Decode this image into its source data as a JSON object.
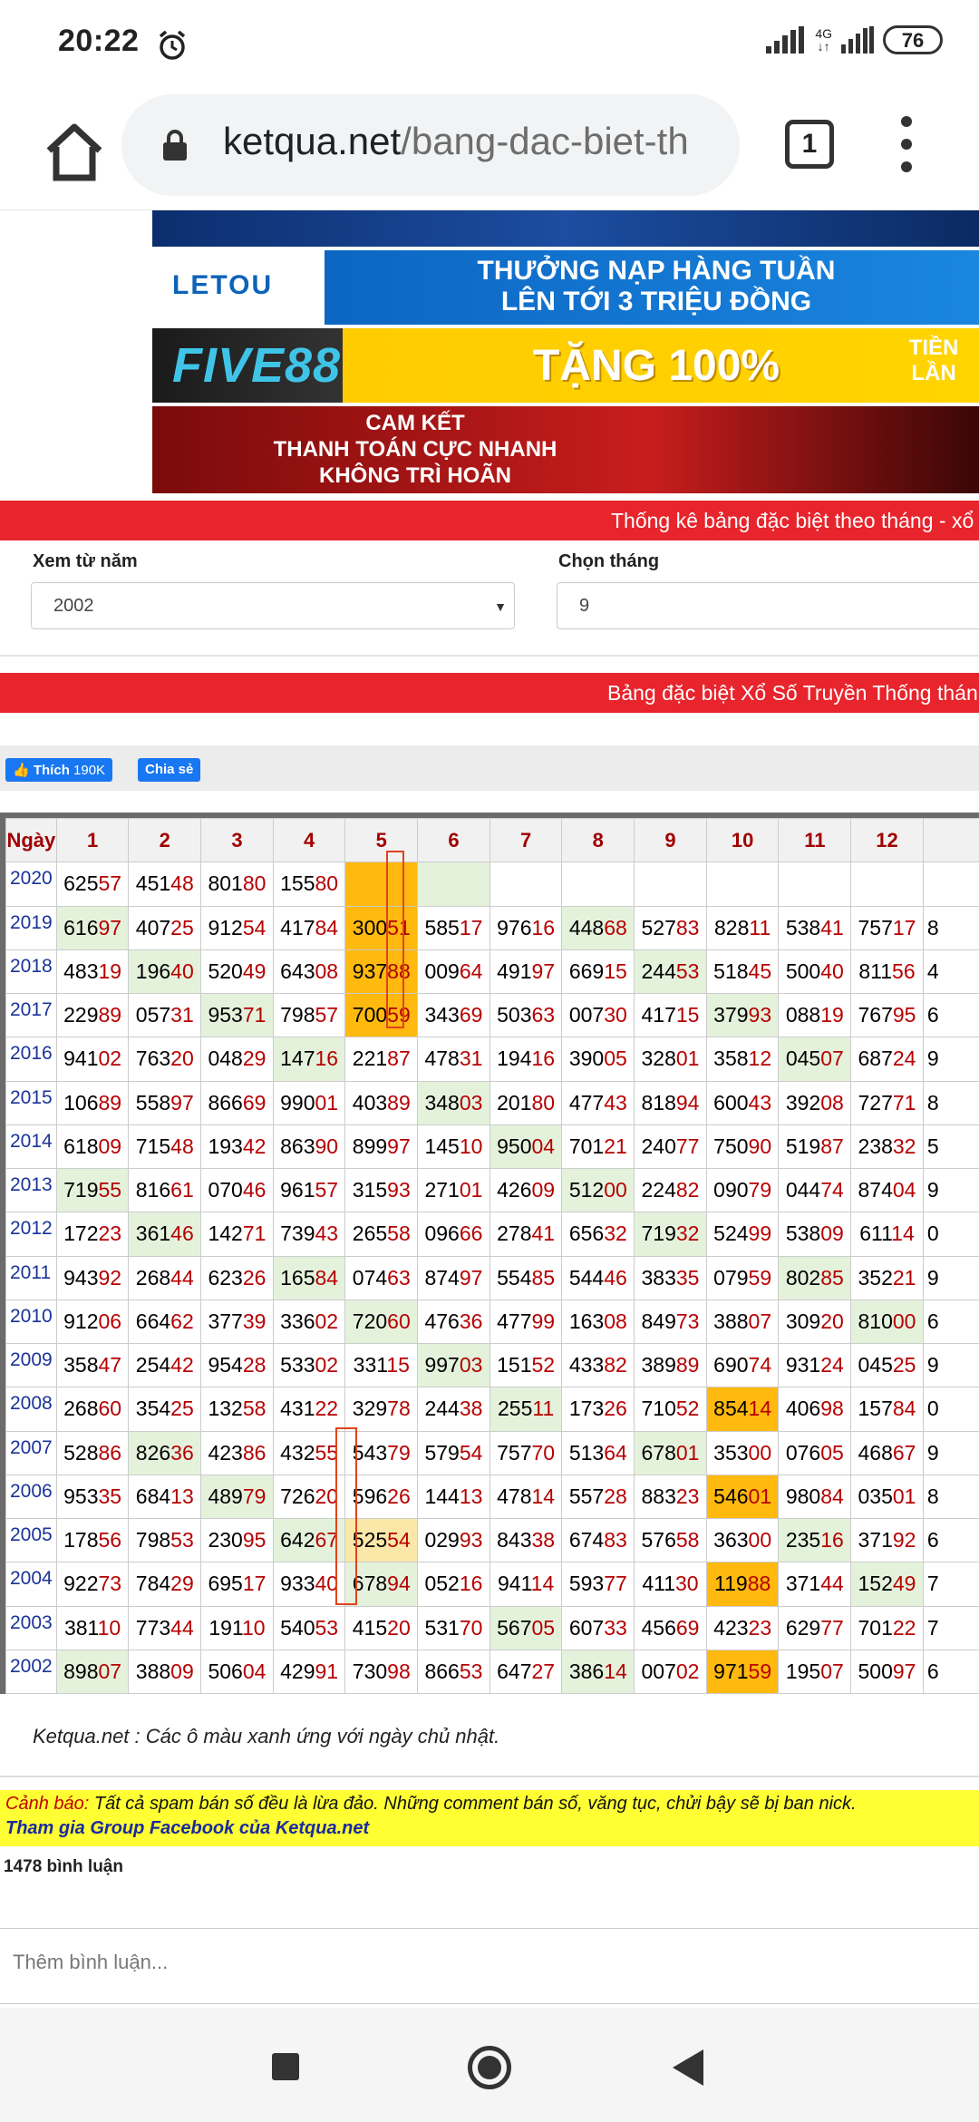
{
  "status_bar": {
    "time": "20:22",
    "network": "4G",
    "battery": "76"
  },
  "browser": {
    "url_domain": "ketqua.net",
    "url_path": "/bang-dac-biet-th",
    "tab_count": "1"
  },
  "banners": [
    {
      "logo": "LETOU",
      "text_line1": "THƯỞNG NẠP HÀNG TUẦN",
      "text_line2": "LÊN TỚI 3 TRIỆU ĐỒNG"
    },
    {
      "logo": "FIVE88",
      "text": "TẶNG 100%",
      "side": "TIỀN LẦN"
    },
    {
      "line1": "CAM KẾT",
      "line2": "THANH TOÁN CỰC NHANH",
      "line3": "KHÔNG TRÌ HOÃN"
    }
  ],
  "section1_title": "Thống kê bảng đặc biệt theo tháng - xổ",
  "filters": {
    "year_label": "Xem từ năm",
    "year_value": "2002",
    "month_label": "Chọn tháng",
    "month_value": "9"
  },
  "section2_title": "Bảng đặc biệt Xổ Số Truyền Thống thán",
  "social": {
    "like_label": "Thích",
    "like_count": "190K",
    "share_label": "Chia sẻ"
  },
  "table": {
    "header_label": "Ngày",
    "columns": [
      "1",
      "2",
      "3",
      "4",
      "5",
      "6",
      "7",
      "8",
      "9",
      "10",
      "11",
      "12"
    ],
    "rows": [
      {
        "year": "2020",
        "cells": [
          "62557",
          "45148",
          "80180",
          "15580",
          "",
          "",
          "",
          "",
          "",
          "",
          "",
          ""
        ],
        "extra": ""
      },
      {
        "year": "2019",
        "cells": [
          "61697",
          "40725",
          "91254",
          "41784",
          "30051",
          "58517",
          "97616",
          "44868",
          "52783",
          "82811",
          "53841",
          "75717"
        ],
        "extra": "8"
      },
      {
        "year": "2018",
        "cells": [
          "48319",
          "19640",
          "52049",
          "64308",
          "93788",
          "00964",
          "49197",
          "66915",
          "24453",
          "51845",
          "50040",
          "81156"
        ],
        "extra": "4"
      },
      {
        "year": "2017",
        "cells": [
          "22989",
          "05731",
          "95371",
          "79857",
          "70059",
          "34369",
          "50363",
          "00730",
          "41715",
          "37993",
          "08819",
          "76795"
        ],
        "extra": "6"
      },
      {
        "year": "2016",
        "cells": [
          "94102",
          "76320",
          "04829",
          "14716",
          "22187",
          "47831",
          "19416",
          "39005",
          "32801",
          "35812",
          "04507",
          "68724"
        ],
        "extra": "9"
      },
      {
        "year": "2015",
        "cells": [
          "10689",
          "55897",
          "86669",
          "99001",
          "40389",
          "34803",
          "20180",
          "47743",
          "81894",
          "60043",
          "39208",
          "72771"
        ],
        "extra": "8"
      },
      {
        "year": "2014",
        "cells": [
          "61809",
          "71548",
          "19342",
          "86390",
          "89997",
          "14510",
          "95004",
          "70121",
          "24077",
          "75090",
          "51987",
          "23832"
        ],
        "extra": "5"
      },
      {
        "year": "2013",
        "cells": [
          "71955",
          "81661",
          "07046",
          "96157",
          "31593",
          "27101",
          "42609",
          "51200",
          "22482",
          "09079",
          "04474",
          "87404"
        ],
        "extra": "9"
      },
      {
        "year": "2012",
        "cells": [
          "17223",
          "36146",
          "14271",
          "73943",
          "26558",
          "09666",
          "27841",
          "65632",
          "71932",
          "52499",
          "53809",
          "61114"
        ],
        "extra": "0"
      },
      {
        "year": "2011",
        "cells": [
          "94392",
          "26844",
          "62326",
          "16584",
          "07463",
          "87497",
          "55485",
          "54446",
          "38335",
          "07959",
          "80285",
          "35221"
        ],
        "extra": "9"
      },
      {
        "year": "2010",
        "cells": [
          "91206",
          "66462",
          "37739",
          "33602",
          "72060",
          "47636",
          "47799",
          "16308",
          "84973",
          "38807",
          "30920",
          "81000"
        ],
        "extra": "6"
      },
      {
        "year": "2009",
        "cells": [
          "35847",
          "25442",
          "95428",
          "53302",
          "33115",
          "99703",
          "15152",
          "43382",
          "38989",
          "69074",
          "93124",
          "04525"
        ],
        "extra": "9"
      },
      {
        "year": "2008",
        "cells": [
          "26860",
          "35425",
          "13258",
          "43122",
          "32978",
          "24438",
          "25511",
          "17326",
          "71052",
          "85414",
          "40698",
          "15784"
        ],
        "extra": "0"
      },
      {
        "year": "2007",
        "cells": [
          "52886",
          "82636",
          "42386",
          "43255",
          "54379",
          "57954",
          "75770",
          "51364",
          "67801",
          "35300",
          "07605",
          "46867"
        ],
        "extra": "9"
      },
      {
        "year": "2006",
        "cells": [
          "95335",
          "68413",
          "48979",
          "72620",
          "59626",
          "14413",
          "47814",
          "55728",
          "88323",
          "54601",
          "98084",
          "03501"
        ],
        "extra": "8"
      },
      {
        "year": "2005",
        "cells": [
          "17856",
          "79853",
          "23095",
          "64267",
          "52554",
          "02993",
          "84338",
          "67483",
          "57658",
          "36300",
          "23516",
          "37192"
        ],
        "extra": "6"
      },
      {
        "year": "2004",
        "cells": [
          "92273",
          "78429",
          "69517",
          "93340",
          "67894",
          "05216",
          "94114",
          "59377",
          "41130",
          "11988",
          "37144",
          "15249"
        ],
        "extra": "7"
      },
      {
        "year": "2003",
        "cells": [
          "38110",
          "77344",
          "19110",
          "54053",
          "41520",
          "53170",
          "56705",
          "60733",
          "45669",
          "42323",
          "62977",
          "70122"
        ],
        "extra": "7"
      },
      {
        "year": "2002",
        "cells": [
          "89807",
          "38809",
          "50604",
          "42991",
          "73098",
          "86653",
          "64727",
          "38614",
          "00702",
          "97159",
          "19507",
          "50097"
        ],
        "extra": "6"
      }
    ],
    "colors": {
      "sunday_green": "#e4f2dc",
      "highlight_orange": "#ffb90f",
      "highlight_yellow": "#fbe8a8",
      "last2_red": "#b60000"
    }
  },
  "note": "Ketqua.net : Các ô màu xanh ứng với ngày chủ nhật.",
  "warning": {
    "label": "Cảnh báo:",
    "text": " Tất cả spam bán số đều là lừa đảo. Những comment bán số, văng tục, chửi bậy sẽ bị ban nick.",
    "group_link": "Tham gia Group Facebook của Ketqua.net"
  },
  "comments": {
    "count_label": "1478 bình luận",
    "input_placeholder": "Thêm bình luận..."
  }
}
